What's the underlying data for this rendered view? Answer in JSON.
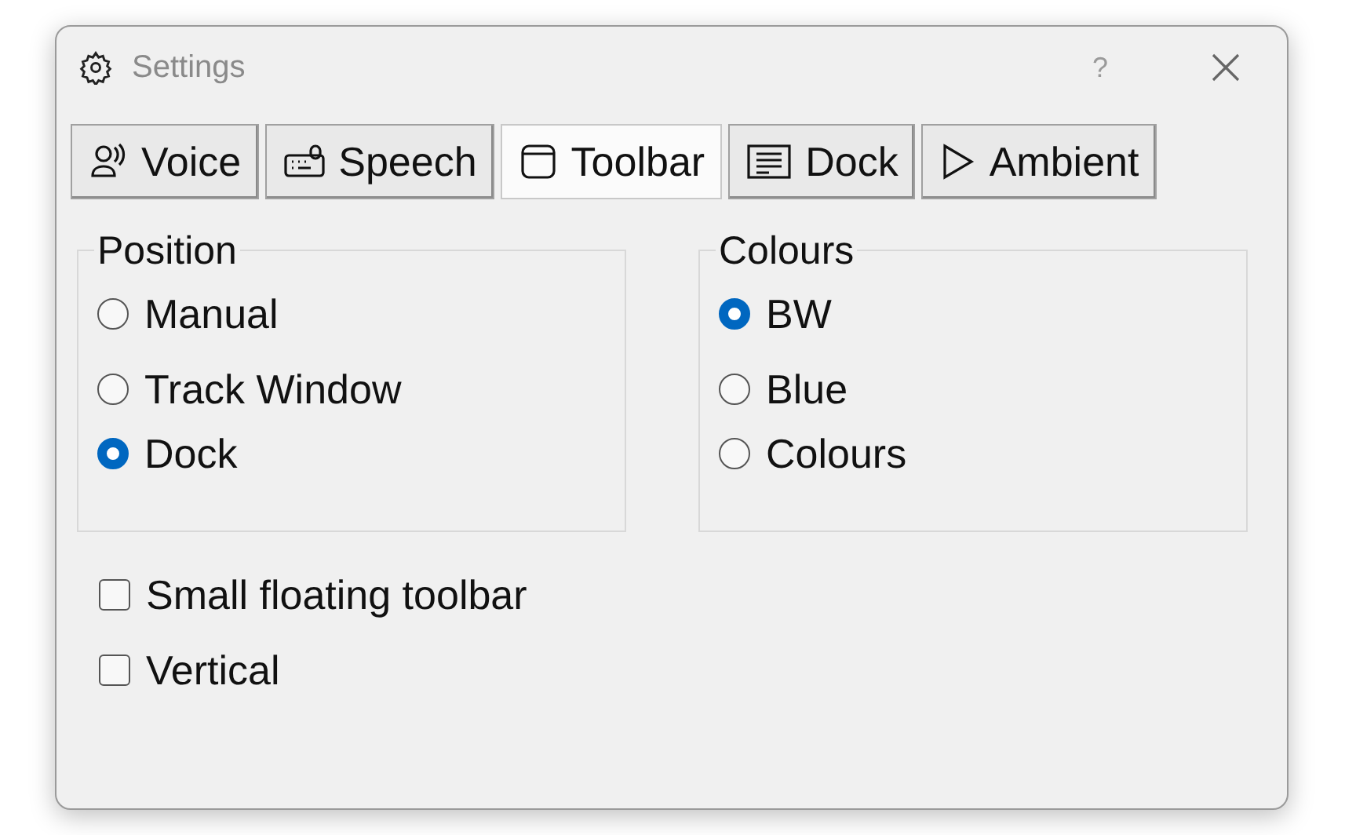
{
  "window": {
    "title": "Settings",
    "help": "?"
  },
  "tabs": [
    {
      "label": "Voice",
      "selected": false
    },
    {
      "label": "Speech",
      "selected": false
    },
    {
      "label": "Toolbar",
      "selected": true
    },
    {
      "label": "Dock",
      "selected": false
    },
    {
      "label": "Ambient",
      "selected": false
    }
  ],
  "groups": [
    {
      "title": "Position",
      "options": [
        {
          "label": "Manual",
          "selected": false
        },
        {
          "label": "Track Window",
          "selected": false
        },
        {
          "label": "Dock",
          "selected": true
        }
      ]
    },
    {
      "title": "Colours",
      "options": [
        {
          "label": "BW",
          "selected": true
        },
        {
          "label": "Blue",
          "selected": false
        },
        {
          "label": "Colours",
          "selected": false
        }
      ]
    }
  ],
  "checkboxes": [
    {
      "label": "Small floating toolbar",
      "checked": false
    },
    {
      "label": "Vertical",
      "checked": false
    }
  ]
}
